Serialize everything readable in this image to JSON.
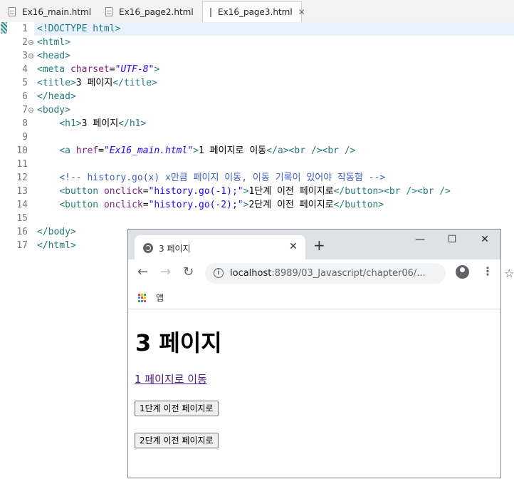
{
  "editor": {
    "tabs": [
      {
        "label": "Ex16_main.html",
        "active": false
      },
      {
        "label": "Ex16_page2.html",
        "active": false
      },
      {
        "label": "Ex16_page3.html",
        "active": true
      }
    ],
    "line_numbers": [
      "1",
      "2",
      "3",
      "4",
      "5",
      "6",
      "7",
      "8",
      "9",
      "10",
      "11",
      "12",
      "13",
      "14",
      "15",
      "16",
      "17"
    ],
    "code": {
      "l1": {
        "doctype": "<!DOCTYPE html>"
      },
      "l2": {
        "open": "<html>"
      },
      "l3": {
        "open": "<head>"
      },
      "l4": {
        "tag": "<meta",
        "attr": "charset",
        "eq": "=",
        "val": "\"UTF-8\"",
        "close": ">"
      },
      "l5": {
        "open": "<title>",
        "text": "3 페이지",
        "close": "</title>"
      },
      "l6": {
        "close": "</head>"
      },
      "l7": {
        "open": "<body>"
      },
      "l8": {
        "open": "<h1>",
        "text": "3 페이지",
        "close": "</h1>"
      },
      "l10": {
        "tag": "<a",
        "attr": "href",
        "eq": "=",
        "val": "\"Ex16_main.html\"",
        "close": ">",
        "text": "1 페이지로 이동",
        "end": "</a><br /><br />"
      },
      "l12": {
        "comment": "<!-- history.go(x) x만큼 페이지 이동, 이동 기록이 있어야 작동함 -->"
      },
      "l13": {
        "tag": "<button",
        "attr": "onclick",
        "eq": "=",
        "val": "\"history.go(-1);\"",
        "close": ">",
        "text": "1단계 이전 페이지로",
        "end": "</button><br /><br />"
      },
      "l14": {
        "tag": "<button",
        "attr": "onclick",
        "eq": "=",
        "val": "\"history.go(-2);\"",
        "close": ">",
        "text": "2단계 이전 페이지로",
        "end": "</button>"
      },
      "l16": {
        "close": "</body>"
      },
      "l17": {
        "close": "</html>"
      }
    }
  },
  "browser": {
    "tab_title": "3 페이지",
    "tab_close": "✕",
    "new_tab": "+",
    "window_controls": {
      "minimize": "—",
      "maximize": "☐",
      "close": "✕"
    },
    "nav": {
      "back": "←",
      "forward": "→",
      "reload": "↻"
    },
    "url_host": "localhost",
    "url_rest": ":8989/03_Javascript/chapter06/...",
    "bookmark_star": "☆",
    "menu": "⋮",
    "apps_label": "앱",
    "apps_colors": [
      "#ea4335",
      "#fbbc05",
      "#34a853",
      "#4285f4",
      "#ea4335",
      "#fbbc05",
      "#34a853",
      "#4285f4",
      "#ea4335"
    ],
    "page": {
      "heading": "3 페이지",
      "link": "1 페이지로 이동",
      "button1": "1단계 이전 페이지로",
      "button2": "2단계 이전 페이지로"
    }
  }
}
